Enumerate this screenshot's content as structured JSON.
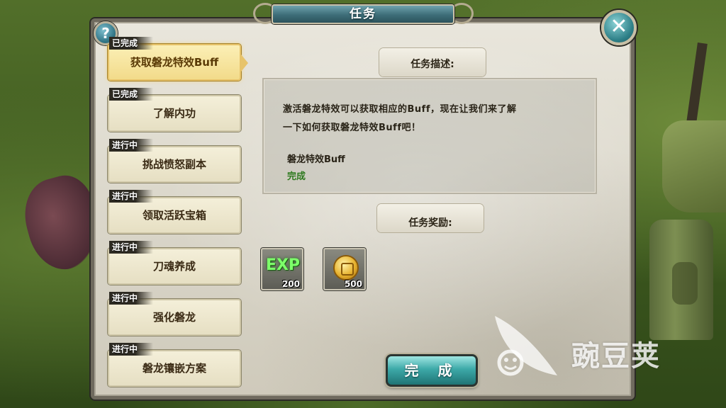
{
  "window": {
    "title": "任务"
  },
  "controls": {
    "help_glyph": "?",
    "close_glyph": "✕"
  },
  "quests": [
    {
      "status": "已完成",
      "name": "获取磐龙特效Buff",
      "active": true
    },
    {
      "status": "已完成",
      "name": "了解内功",
      "active": false
    },
    {
      "status": "进行中",
      "name": "挑战愤怒副本",
      "active": false
    },
    {
      "status": "进行中",
      "name": "领取活跃宝箱",
      "active": false
    },
    {
      "status": "进行中",
      "name": "刀魂养成",
      "active": false
    },
    {
      "status": "进行中",
      "name": "强化磐龙",
      "active": false
    },
    {
      "status": "进行中",
      "name": "磐龙镶嵌方案",
      "active": false
    }
  ],
  "description": {
    "heading": "任务描述:",
    "line1": "激活磐龙特效可以获取相应的Buff，现在让我们来了解",
    "line2": "一下如何获取磐龙特效Buff吧！",
    "objective": "磐龙特效Buff",
    "objective_status": "完成"
  },
  "rewards": {
    "heading": "任务奖励:",
    "items": [
      {
        "icon": "exp-icon",
        "label": "EXP",
        "qty": "200"
      },
      {
        "icon": "gold-coin-icon",
        "label": "",
        "qty": "500"
      }
    ]
  },
  "complete_button": {
    "label": "完 成"
  },
  "watermark": {
    "text": "豌豆荚"
  },
  "colors": {
    "title_tab": "#3d6d78",
    "button_teal": "#3da9a8",
    "active_quest": "#f2db8a",
    "status_done": "#2e7a1f"
  }
}
